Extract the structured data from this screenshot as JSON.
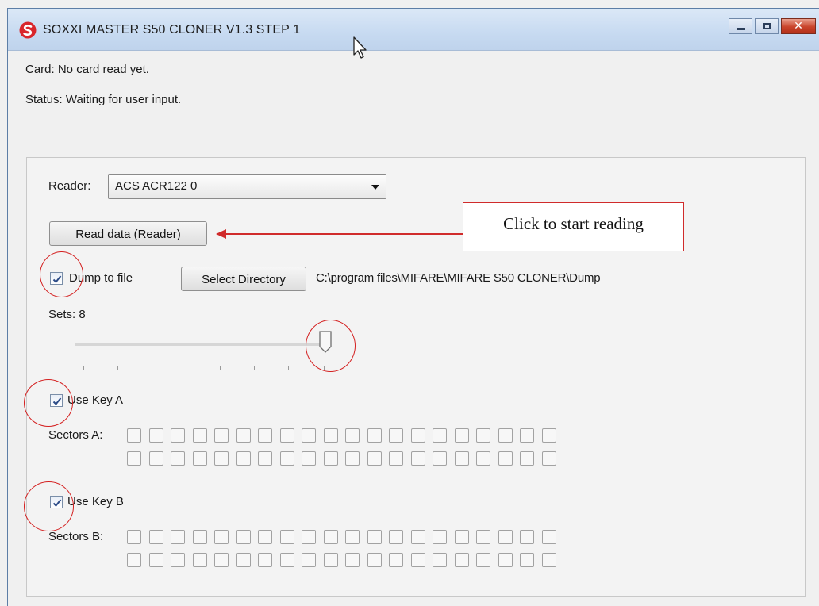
{
  "window": {
    "title": "SOXXI MASTER S50 CLONER  V1.3  STEP 1",
    "logo_color": "#d9262c",
    "controls": [
      "minimize-icon",
      "maximize-icon",
      "close-icon"
    ]
  },
  "info": {
    "card": "Card: No card read yet.",
    "status": "Status: Waiting for user input."
  },
  "reader": {
    "label": "Reader:",
    "selected": "ACS ACR122 0"
  },
  "read_button": "Read data (Reader)",
  "callout": {
    "text": "Click to start reading",
    "color": "#d02b2b"
  },
  "dump": {
    "label": "Dump to file",
    "checked": true,
    "select_directory_button": "Select Directory",
    "path": "C:\\program files\\MIFARE\\MIFARE S50 CLONER\\Dump"
  },
  "sets": {
    "label": "Sets: 8",
    "value": 8,
    "min": 1,
    "max": 8
  },
  "key_a": {
    "label": "Use Key A",
    "checked": true,
    "sectors_label": "Sectors A:",
    "sector_count": 40
  },
  "key_b": {
    "label": "Use Key B",
    "checked": true,
    "sectors_label": "Sectors B:",
    "sector_count": 40
  },
  "annotation_color": "#d42020"
}
